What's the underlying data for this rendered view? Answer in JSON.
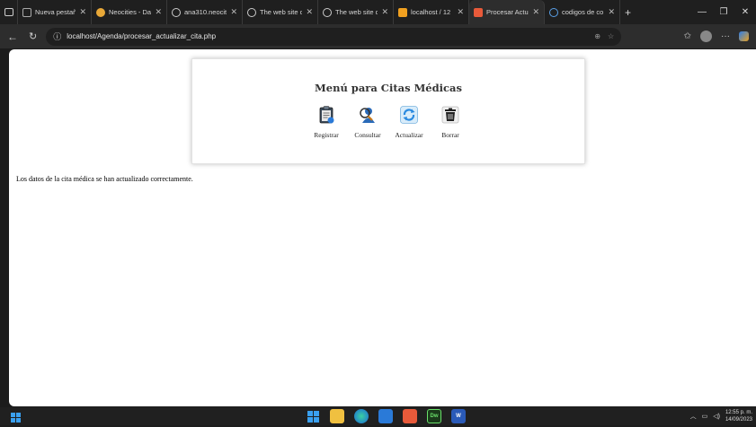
{
  "browser": {
    "tabs": [
      {
        "label": "",
        "icon": "tab-actions-icon"
      },
      {
        "label": "Nueva pestañ",
        "icon": "newtab-icon"
      },
      {
        "label": "Neocities - Da",
        "icon": "neocities-icon"
      },
      {
        "label": "ana310.neocit",
        "icon": "globe-icon"
      },
      {
        "label": "The web site c",
        "icon": "globe-icon"
      },
      {
        "label": "The web site c",
        "icon": "globe-icon"
      },
      {
        "label": "localhost / 12",
        "icon": "phpmyadmin-icon"
      },
      {
        "label": "Procesar Actu",
        "icon": "page-icon",
        "active": true
      },
      {
        "label": "codigos de co",
        "icon": "search-icon"
      }
    ],
    "new_tab_label": "+",
    "url": "localhost/Agenda/procesar_actualizar_cita.php"
  },
  "page": {
    "title": "Menú para Citas Médicas",
    "menu": [
      {
        "label": "Registrar",
        "icon": "clipboard-icon"
      },
      {
        "label": "Consultar",
        "icon": "search-person-icon"
      },
      {
        "label": "Actualizar",
        "icon": "refresh-icon"
      },
      {
        "label": "Borrar",
        "icon": "trash-icon"
      }
    ],
    "message": "Los datos de la cita médica se han actualizado correctamente."
  },
  "taskbar": {
    "time": "12:55 p. m.",
    "date": "14/09/2023"
  }
}
